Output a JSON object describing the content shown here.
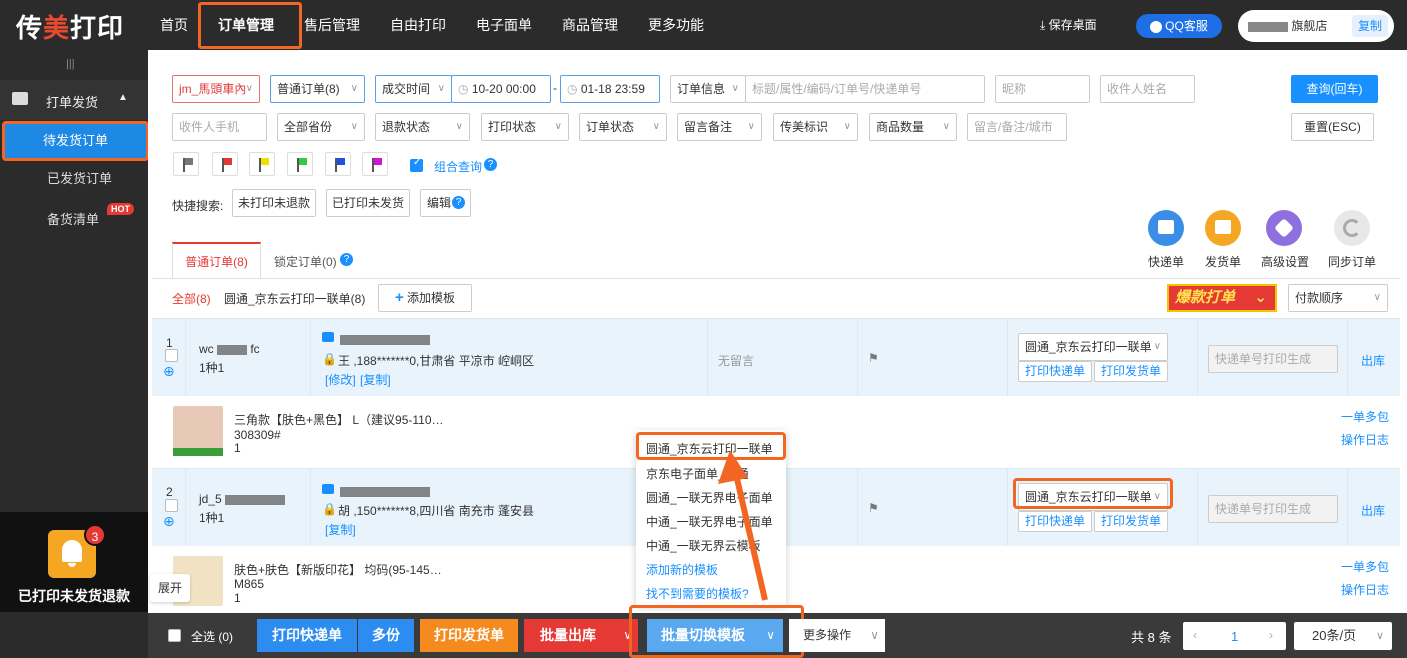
{
  "app": {
    "logo_a": "传",
    "logo_m": "美",
    "logo_b": "打印"
  },
  "nav": [
    "首页",
    "订单管理",
    "售后管理",
    "自由打印",
    "电子面单",
    "商品管理",
    "更多功能"
  ],
  "topbar": {
    "save_desktop": "保存桌面",
    "qq": "QQ客服",
    "shop": "旗舰店",
    "copy": "复制"
  },
  "sidebar": {
    "collapse": "|||",
    "section": "打单发货",
    "items": [
      "待发货订单",
      "已发货订单",
      "备货清单"
    ],
    "hot": "HOT",
    "promo": "已打印未发货退款",
    "badge": "3",
    "expand": "展开"
  },
  "filters": {
    "shop": "jm_馬頭車內",
    "order_type": "普通订单(8)",
    "time_type": "成交时间",
    "date_from": "10-20 00:00",
    "date_sep": "-",
    "date_to": "01-18 23:59",
    "order_info": "订单信息",
    "order_info_ph": "标题/属性/编码/订单号/快递单号",
    "nickname_ph": "昵称",
    "receiver_ph": "收件人姓名",
    "query": "查询(回车)",
    "phone_ph": "收件人手机",
    "province": "全部省份",
    "refund": "退款状态",
    "print": "打印状态",
    "order_status": "订单状态",
    "remark": "留言备注",
    "cm_flag": "传美标识",
    "qty": "商品数量",
    "remark_ph": "留言/备注/城市",
    "reset": "重置(ESC)",
    "combo": "组合查询",
    "quick_label": "快捷搜索:",
    "quick": [
      "未打印未退款",
      "已打印未发货",
      "编辑"
    ]
  },
  "icons": [
    {
      "name": "express-icon",
      "label": "快递单",
      "color": "#3a8ee6"
    },
    {
      "name": "invoice-icon",
      "label": "发货单",
      "color": "#f5a623"
    },
    {
      "name": "settings-icon",
      "label": "高级设置",
      "color": "#8e6fe0"
    },
    {
      "name": "sync-icon",
      "label": "同步订单",
      "color": "#bbbbbb"
    }
  ],
  "tabs": [
    "普通订单(8)",
    "锁定订单(0)"
  ],
  "subtabs": {
    "all": "全部(8)",
    "tpl": "圆通_京东云打印一联单(8)",
    "add_tpl": "添加模板",
    "hot_print": "爆款打单",
    "sort": "付款顺序"
  },
  "orders": [
    {
      "num": "1",
      "buyer": "wc",
      "kinds": "1种1",
      "addr": "王  ,188*******0,甘肃省 平凉市 崆峒区",
      "modify": "[修改]",
      "copy": "[复制]",
      "note": "无留言",
      "template": "圆通_京东云打印一联单",
      "print_express": "打印快递单",
      "print_invoice": "打印发货单",
      "tracking_ph": "快递单号打印生成",
      "out": "出库",
      "item": {
        "title": "三角款【肤色+黑色】 L（建议95-110…",
        "code": "308309#",
        "count": "1"
      },
      "more1": "一单多包",
      "more2": "操作日志"
    },
    {
      "num": "2",
      "buyer": "jd_5",
      "kinds": "1种1",
      "addr": "胡  ,150*******8,四川省 南充市 蓬安县",
      "copy": "[复制]",
      "template": "圆通_京东云打印一联单",
      "print_express": "打印快递单",
      "print_invoice": "打印发货单",
      "tracking_ph": "快递单号打印生成",
      "out": "出库",
      "item": {
        "title": "肤色+肤色【新版印花】 均码(95-145…",
        "code": "M865",
        "count": "1"
      },
      "more1": "一单多包",
      "more2": "操作日志"
    }
  ],
  "dropdown": [
    "圆通_京东云打印一联单",
    "京东电子面单_圆通",
    "圆通_一联无界电子面单",
    "中通_一联无界电子面单",
    "中通_一联无界云模板",
    "添加新的模板",
    "找不到需要的模板?"
  ],
  "bottom": {
    "select_all": "全选 (0)",
    "print_express": "打印快递单",
    "multi": "多份",
    "print_invoice": "打印发货单",
    "batch_out": "批量出库",
    "batch_switch": "批量切换模板",
    "more_ops": "更多操作",
    "total": "共 8 条",
    "page": "1",
    "per_page": "20条/页"
  }
}
